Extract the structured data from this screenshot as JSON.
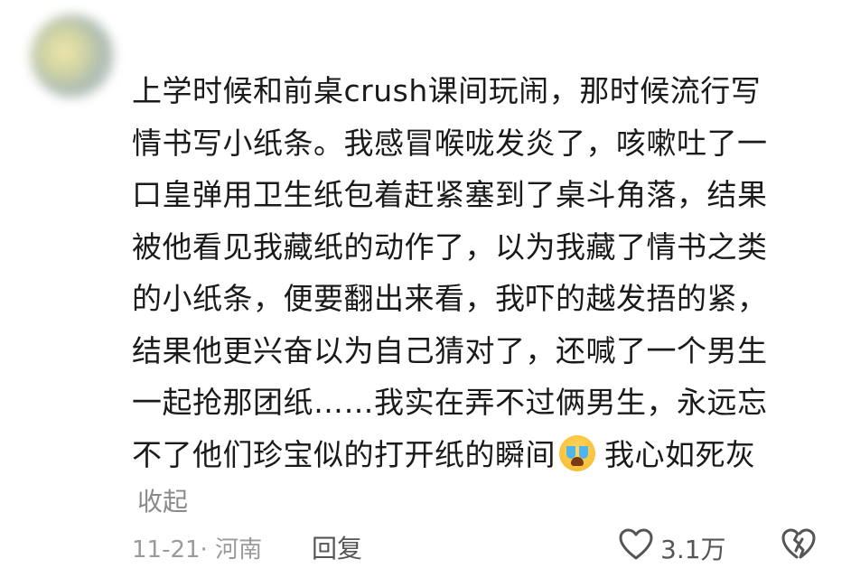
{
  "comment": {
    "lines": [
      "上学时候和前桌crush课间玩闹，那时候流行写",
      "情书写小纸条。我感冒喉咙发炎了，咳嗽吐了一",
      "口皇弹用卫生纸包着赶紧塞到了桌斗角落，结果",
      "被他看见我藏纸的动作了，以为我藏了情书之类",
      "的小纸条，便要翻出来看，我吓的越发捂的紧，",
      "结果他更兴奋以为自己猜对了，还喊了一个男生",
      "一起抢那团纸……我实在弄不过俩男生，永远忘",
      "不了他们珍宝似的打开纸的瞬间",
      "我心如死灰"
    ],
    "emoji": "crying-face-emoji"
  },
  "actions": {
    "collapse_label": "收起",
    "meta": "11-21· 河南",
    "reply_label": "回复",
    "like_count": "3.1万"
  },
  "icons": {
    "like": "heart-icon",
    "dislike": "broken-heart-icon"
  },
  "colors": {
    "text": "#1a1a1a",
    "secondary": "#9a9a9a",
    "icon": "#555555"
  }
}
